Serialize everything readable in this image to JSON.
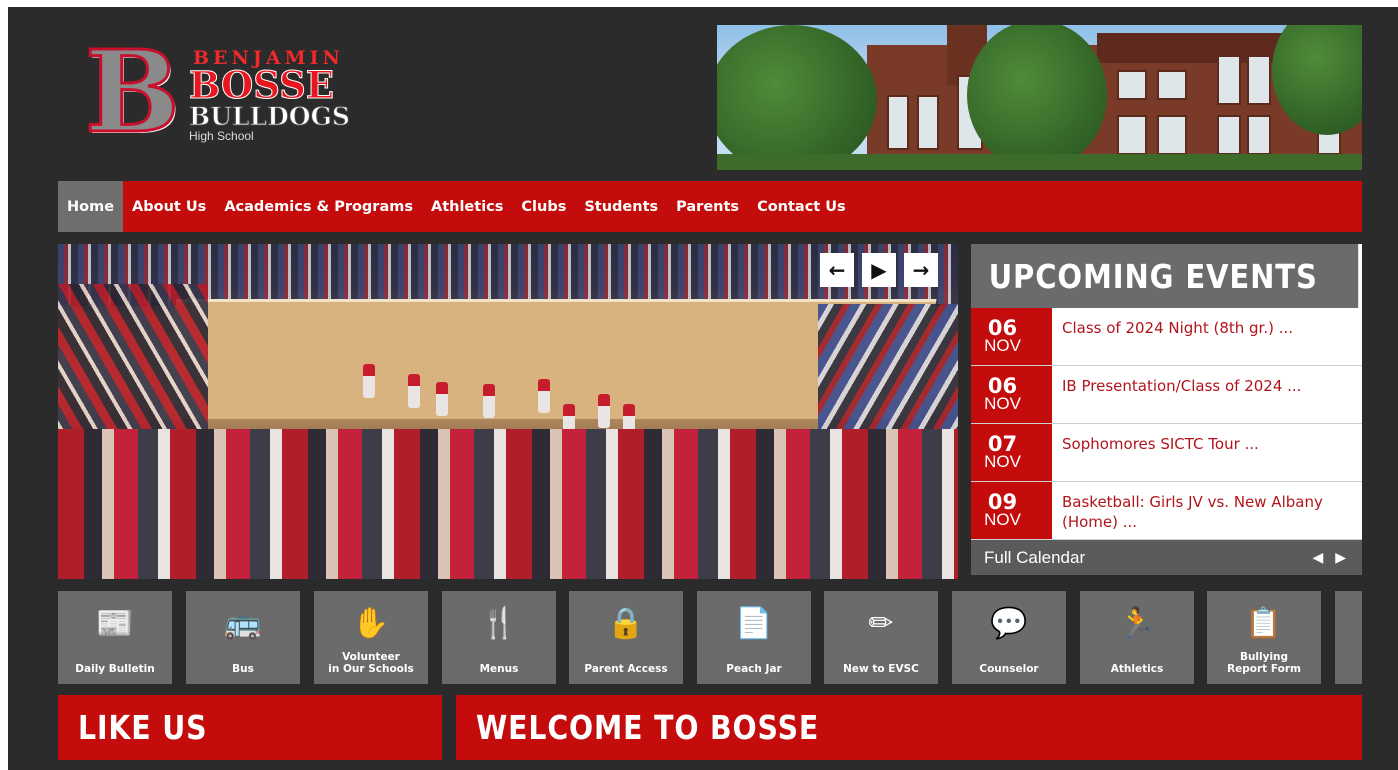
{
  "logo": {
    "first_name": "BENJAMIN",
    "last_name": "BOSSE",
    "mascot": "BULLDOGS",
    "subtitle": "High School",
    "letter": "B"
  },
  "nav": {
    "items": [
      {
        "label": "Home",
        "active": true
      },
      {
        "label": "About Us"
      },
      {
        "label": "Academics & Programs"
      },
      {
        "label": "Athletics"
      },
      {
        "label": "Clubs"
      },
      {
        "label": "Students"
      },
      {
        "label": "Parents"
      },
      {
        "label": "Contact Us"
      }
    ]
  },
  "slider": {
    "prev_icon": "←",
    "play_icon": "▶",
    "next_icon": "→"
  },
  "events": {
    "title": "UPCOMING EVENTS",
    "items": [
      {
        "day": "06",
        "month": "NOV",
        "title": "Class of 2024 Night (8th gr.) ..."
      },
      {
        "day": "06",
        "month": "NOV",
        "title": "IB Presentation/Class of 2024 ..."
      },
      {
        "day": "07",
        "month": "NOV",
        "title": "Sophomores SICTC Tour ..."
      },
      {
        "day": "09",
        "month": "NOV",
        "title": "Basketball: Girls JV vs. New Albany (Home) ..."
      }
    ],
    "footer_label": "Full Calendar",
    "prev_icon": "◀",
    "next_icon": "▶"
  },
  "quick_links": [
    {
      "label": "Daily Bulletin",
      "icon": "📰"
    },
    {
      "label": "Bus",
      "icon": "🚌"
    },
    {
      "label": "Volunteer\nin Our Schools",
      "icon": "✋"
    },
    {
      "label": "Menus",
      "icon": "🍴"
    },
    {
      "label": "Parent Access",
      "icon": "🔒"
    },
    {
      "label": "Peach Jar",
      "icon": "📄"
    },
    {
      "label": "New to EVSC",
      "icon": "✏"
    },
    {
      "label": "Counselor",
      "icon": "💬"
    },
    {
      "label": "Athletics",
      "icon": "🏃"
    },
    {
      "label": "Bullying\nReport Form",
      "icon": "📋"
    }
  ],
  "sections": {
    "like_us": "LIKE US",
    "welcome": "WELCOME TO BOSSE"
  },
  "colors": {
    "brand_red": "#c40c0c",
    "panel_gray": "#6b6b6b",
    "page_dark": "#2b2b2b"
  }
}
